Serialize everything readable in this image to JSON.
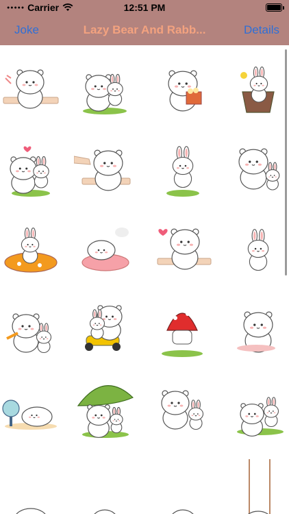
{
  "status": {
    "carrier": "Carrier",
    "time": "12:51 PM"
  },
  "nav": {
    "left_label": "Joke",
    "title": "Lazy Bear And Rabb...",
    "right_label": "Details"
  },
  "colors": {
    "bar_background": "#b3837e",
    "button_text": "#2f6fd6",
    "title_text": "#f3a27f"
  },
  "stickers": [
    {
      "name": "bear-leaning-on-ledge"
    },
    {
      "name": "bear-and-rabbit-hugging"
    },
    {
      "name": "bear-eating-popcorn"
    },
    {
      "name": "rabbit-in-flower-pot"
    },
    {
      "name": "bear-and-rabbit-kiss"
    },
    {
      "name": "bear-poked-by-hand"
    },
    {
      "name": "rabbit-standing-on-grass"
    },
    {
      "name": "bear-with-rabbit-on-side"
    },
    {
      "name": "rabbit-on-orange-cushion"
    },
    {
      "name": "bear-lying-on-pink-cushion"
    },
    {
      "name": "bear-with-heart-on-ledge"
    },
    {
      "name": "rabbit-hands-on-hips"
    },
    {
      "name": "bear-giving-carrot-to-rabbit"
    },
    {
      "name": "bear-and-rabbit-on-scooter"
    },
    {
      "name": "rabbit-hiding-in-red-hood"
    },
    {
      "name": "bear-with-flowers"
    },
    {
      "name": "bear-resting-by-fan"
    },
    {
      "name": "bear-and-rabbit-under-leaf"
    },
    {
      "name": "bear-and-rabbit-waving"
    },
    {
      "name": "bear-and-rabbit-cuddling"
    },
    {
      "name": "bear-peeking"
    },
    {
      "name": "rabbit-peeking"
    },
    {
      "name": "bear-bottom-peeking"
    },
    {
      "name": "rabbit-on-swing"
    }
  ]
}
